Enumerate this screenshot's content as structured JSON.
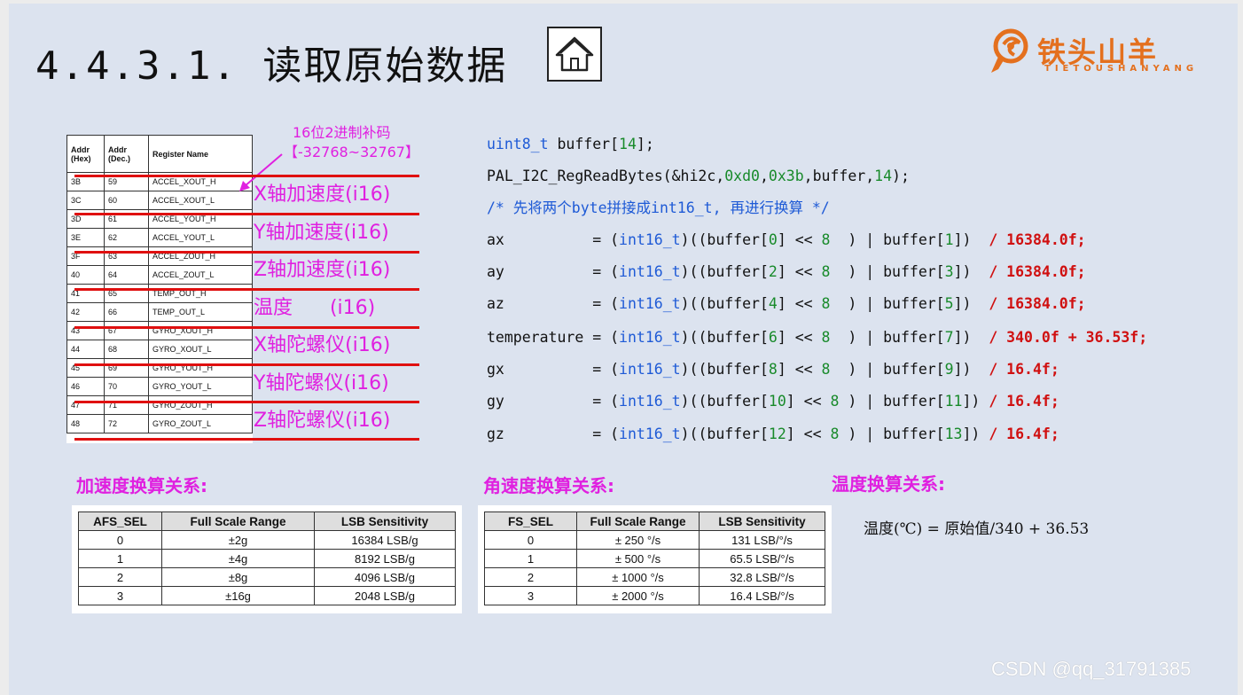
{
  "header": {
    "title": "4.4.3.1. 读取原始数据",
    "home_icon": "home-icon",
    "logo_name": "铁头山羊",
    "logo_sub": "TIETOUSHANYANG"
  },
  "register_table": {
    "headers": [
      "Addr (Hex)",
      "Addr (Dec.)",
      "Register Name"
    ],
    "rows": [
      [
        "3B",
        "59",
        "ACCEL_XOUT_H"
      ],
      [
        "3C",
        "60",
        "ACCEL_XOUT_L"
      ],
      [
        "3D",
        "61",
        "ACCEL_YOUT_H"
      ],
      [
        "3E",
        "62",
        "ACCEL_YOUT_L"
      ],
      [
        "3F",
        "63",
        "ACCEL_ZOUT_H"
      ],
      [
        "40",
        "64",
        "ACCEL_ZOUT_L"
      ],
      [
        "41",
        "65",
        "TEMP_OUT_H"
      ],
      [
        "42",
        "66",
        "TEMP_OUT_L"
      ],
      [
        "43",
        "67",
        "GYRO_XOUT_H"
      ],
      [
        "44",
        "68",
        "GYRO_XOUT_L"
      ],
      [
        "45",
        "69",
        "GYRO_YOUT_H"
      ],
      [
        "46",
        "70",
        "GYRO_YOUT_L"
      ],
      [
        "47",
        "71",
        "GYRO_ZOUT_H"
      ],
      [
        "48",
        "72",
        "GYRO_ZOUT_L"
      ]
    ],
    "annotation_line1": "16位2进制补码",
    "annotation_line2": "【-32768~32767】",
    "axis_labels": [
      "X轴加速度(i16)",
      "Y轴加速度(i16)",
      "Z轴加速度(i16)",
      "温度      (i16)",
      "X轴陀螺仪(i16)",
      "Y轴陀螺仪(i16)",
      "Z轴陀螺仪(i16)"
    ]
  },
  "code": {
    "line1": {
      "type": "uint8_t",
      "rest": " buffer[",
      "num": "14",
      "end": "];"
    },
    "line2": {
      "func": "PAL_I2C_RegReadBytes(&hi2c,",
      "a": "0xd0",
      "b": "0x3b",
      "rest": ",buffer,",
      "num": "14",
      "end": ");"
    },
    "comment": "/* 先将两个byte拼接成int16_t, 再进行换算 */",
    "assignments": [
      {
        "var": "ax         ",
        "hi": "0",
        "lo": "1",
        "pad1": "  ",
        "pad2": " ",
        "scale": "/ 16384.0f;"
      },
      {
        "var": "ay         ",
        "hi": "2",
        "lo": "3",
        "pad1": "  ",
        "pad2": " ",
        "scale": "/ 16384.0f;"
      },
      {
        "var": "az         ",
        "hi": "4",
        "lo": "5",
        "pad1": "  ",
        "pad2": " ",
        "scale": "/ 16384.0f;"
      },
      {
        "var": "temperature",
        "hi": "6",
        "lo": "7",
        "pad1": "  ",
        "pad2": " ",
        "scale": "/ 340.0f + 36.53f;"
      },
      {
        "var": "gx         ",
        "hi": "8",
        "lo": "9",
        "pad1": "  ",
        "pad2": " ",
        "scale": "/ 16.4f;"
      },
      {
        "var": "gy         ",
        "hi": "10",
        "lo": "11",
        "pad1": " ",
        "pad2": "",
        "scale": "/ 16.4f;"
      },
      {
        "var": "gz         ",
        "hi": "12",
        "lo": "13",
        "pad1": " ",
        "pad2": "",
        "scale": "/ 16.4f;"
      }
    ],
    "cast": "int16_t",
    "shift": "8"
  },
  "accel_section": {
    "heading": "加速度换算关系:",
    "headers": [
      "AFS_SEL",
      "Full Scale Range",
      "LSB Sensitivity"
    ],
    "rows": [
      [
        "0",
        "±2g",
        "16384 LSB/g"
      ],
      [
        "1",
        "±4g",
        "8192 LSB/g"
      ],
      [
        "2",
        "±8g",
        "4096 LSB/g"
      ],
      [
        "3",
        "±16g",
        "2048 LSB/g"
      ]
    ]
  },
  "gyro_section": {
    "heading": "角速度换算关系:",
    "headers": [
      "FS_SEL",
      "Full Scale Range",
      "LSB Sensitivity"
    ],
    "rows": [
      [
        "0",
        "± 250 °/s",
        "131 LSB/°/s"
      ],
      [
        "1",
        "± 500 °/s",
        "65.5 LSB/°/s"
      ],
      [
        "2",
        "± 1000 °/s",
        "32.8 LSB/°/s"
      ],
      [
        "3",
        "± 2000 °/s",
        "16.4 LSB/°/s"
      ]
    ]
  },
  "temp_section": {
    "heading": "温度换算关系:",
    "formula": "温度(℃) = 原始值/340 + 36.53"
  },
  "watermark": "CSDN @qq_31791385",
  "colors": {
    "magenta": "#e020e0",
    "red": "#e01010",
    "keyword_blue": "#1e5ad6",
    "number_green": "#188a2a",
    "logo_orange": "#e4701e"
  }
}
